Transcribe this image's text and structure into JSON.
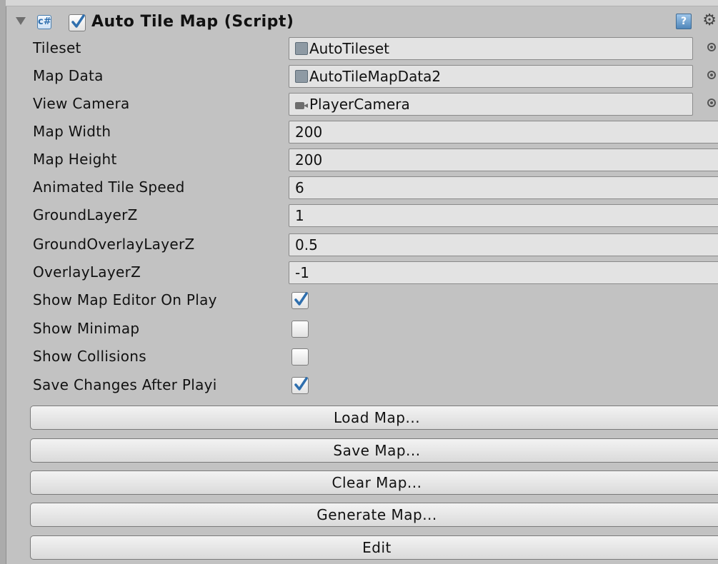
{
  "component": {
    "title": "Auto Tile Map (Script)",
    "enabled": true
  },
  "fields": {
    "tileset": {
      "label": "Tileset",
      "value": "AutoTileset"
    },
    "map_data": {
      "label": "Map Data",
      "value": "AutoTileMapData2"
    },
    "view_camera": {
      "label": "View Camera",
      "value": "PlayerCamera"
    },
    "map_width": {
      "label": "Map Width",
      "value": "200"
    },
    "map_height": {
      "label": "Map Height",
      "value": "200"
    },
    "animated_tile_speed": {
      "label": "Animated Tile Speed",
      "value": "6"
    },
    "ground_layer_z": {
      "label": "GroundLayerZ",
      "value": "1"
    },
    "ground_overlay_layer_z": {
      "label": "GroundOverlayLayerZ",
      "value": "0.5"
    },
    "overlay_layer_z": {
      "label": "OverlayLayerZ",
      "value": "-1"
    }
  },
  "toggles": {
    "show_map_editor_on_play": {
      "label": "Show Map Editor On Play",
      "checked": true
    },
    "show_minimap": {
      "label": "Show Minimap",
      "checked": false
    },
    "show_collisions": {
      "label": "Show Collisions",
      "checked": false
    },
    "save_changes_after_playing": {
      "label": "Save Changes After Playi",
      "checked": true
    }
  },
  "buttons": {
    "load": "Load Map...",
    "save": "Save Map...",
    "clear": "Clear Map...",
    "generate": "Generate Map...",
    "edit": "Edit"
  },
  "icons": {
    "help": "help-icon",
    "settings": "gear-icon",
    "script": "csharp-script-icon"
  },
  "colors": {
    "background": "#c2c2c2",
    "field": "#e3e3e3",
    "check": "#2f6fae"
  }
}
